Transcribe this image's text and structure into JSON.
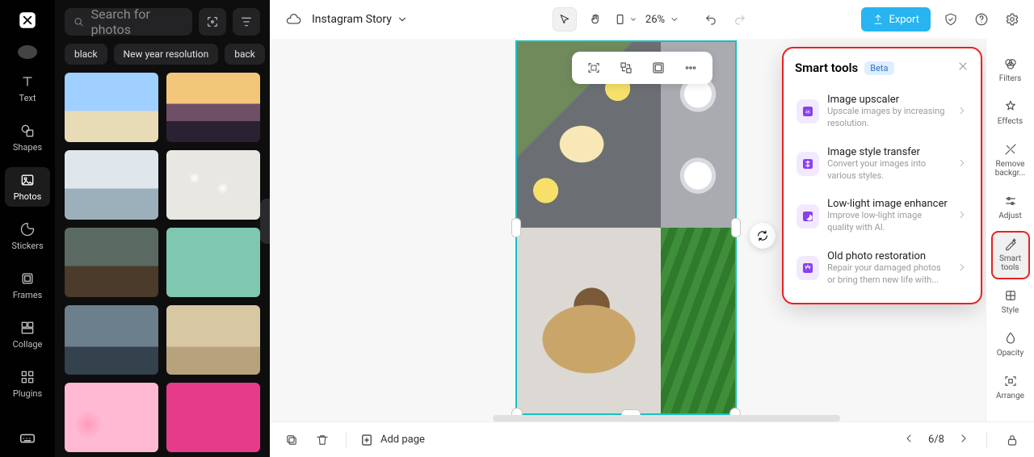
{
  "rail": {
    "items": [
      "Text",
      "Shapes",
      "Photos",
      "Stickers",
      "Frames",
      "Collage",
      "Plugins"
    ],
    "active": 2
  },
  "search": {
    "placeholder": "Search for photos"
  },
  "chips": [
    "black",
    "New year resolution",
    "back"
  ],
  "topbar": {
    "project": "Instagram Story",
    "zoom": "26%",
    "export": "Export"
  },
  "smartTools": {
    "title": "Smart tools",
    "badge": "Beta",
    "items": [
      {
        "title": "Image upscaler",
        "desc": "Upscale images by increasing resolution."
      },
      {
        "title": "Image style transfer",
        "desc": "Convert your images into various styles."
      },
      {
        "title": "Low-light image enhancer",
        "desc": "Improve low-light image quality with AI."
      },
      {
        "title": "Old photo restoration",
        "desc": "Repair your damaged photos or bring them new life with..."
      }
    ]
  },
  "rightRail": {
    "items": [
      "Filters",
      "Effects",
      "Remove backgr...",
      "Adjust",
      "Smart tools",
      "Style",
      "Opacity",
      "Arrange"
    ],
    "active": 4
  },
  "bottom": {
    "addPage": "Add page",
    "page": "6/8"
  }
}
